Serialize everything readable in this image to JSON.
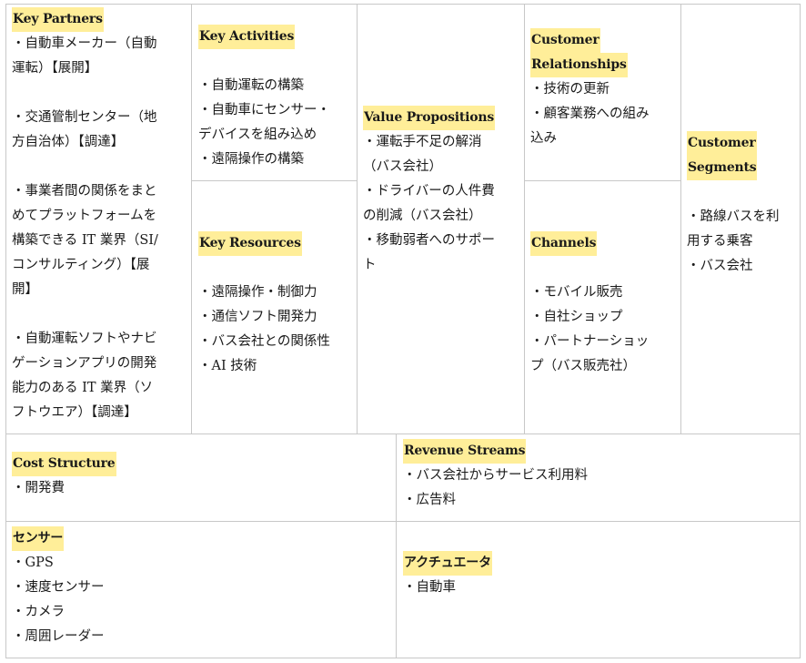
{
  "key_partners": {
    "heading": "Key Partners",
    "items": [
      "・自動車メーカー（自動\n運転）【展開】",
      "・交通管制センター（地\n方自治体）【調達】",
      "・事業者間の関係をまと\nめてプラットフォームを\n構築できる IT 業界（SI/\nコンサルティング）【展\n開】",
      "・自動運転ソフトやナビ\nゲーションアプリの開発\n能力のある IT 業界（ソ\nフトウエア）【調達】"
    ]
  },
  "key_activities": {
    "heading": "Key Activities",
    "items": [
      "・自動運転の構築",
      "・自動車にセンサー・\nデバイスを組み込め",
      "・遠隔操作の構築"
    ]
  },
  "key_resources": {
    "heading": "Key Resources",
    "items": [
      "・遠隔操作・制御力",
      "・通信ソフト開発力",
      "・バス会社との関係性",
      "・AI 技術"
    ]
  },
  "value_propositions": {
    "heading": "Value Propositions",
    "items": [
      "・運転手不足の解消\n（バス会社）",
      "・ドライバーの人件費\nの削減（バス会社）",
      "・移動弱者へのサポー\nト"
    ]
  },
  "customer_relationships": {
    "heading_line1": "Customer",
    "heading_line2": "Relationships",
    "items": [
      "・技術の更新",
      "・顧客業務への組み\n込み"
    ]
  },
  "channels": {
    "heading": "Channels",
    "items": [
      "・モバイル販売",
      "・自社ショップ",
      "・パートナーショッ\nプ（バス販売社）"
    ]
  },
  "customer_segments": {
    "heading_line1": "Customer",
    "heading_line2": "Segments",
    "items": [
      "・路線バスを利\n用する乗客",
      "・バス会社"
    ]
  },
  "cost_structure": {
    "heading": "Cost Structure",
    "items": [
      "・開発費"
    ]
  },
  "revenue_streams": {
    "heading": "Revenue Streams",
    "items": [
      "・バス会社からサービス利用料",
      "・広告料"
    ]
  },
  "sensors": {
    "heading": "センサー",
    "items": [
      "・GPS",
      "・速度センサー",
      "・カメラ",
      "・周囲レーダー"
    ]
  },
  "actuators": {
    "heading": "アクチュエータ",
    "items": [
      "・自動車"
    ]
  }
}
